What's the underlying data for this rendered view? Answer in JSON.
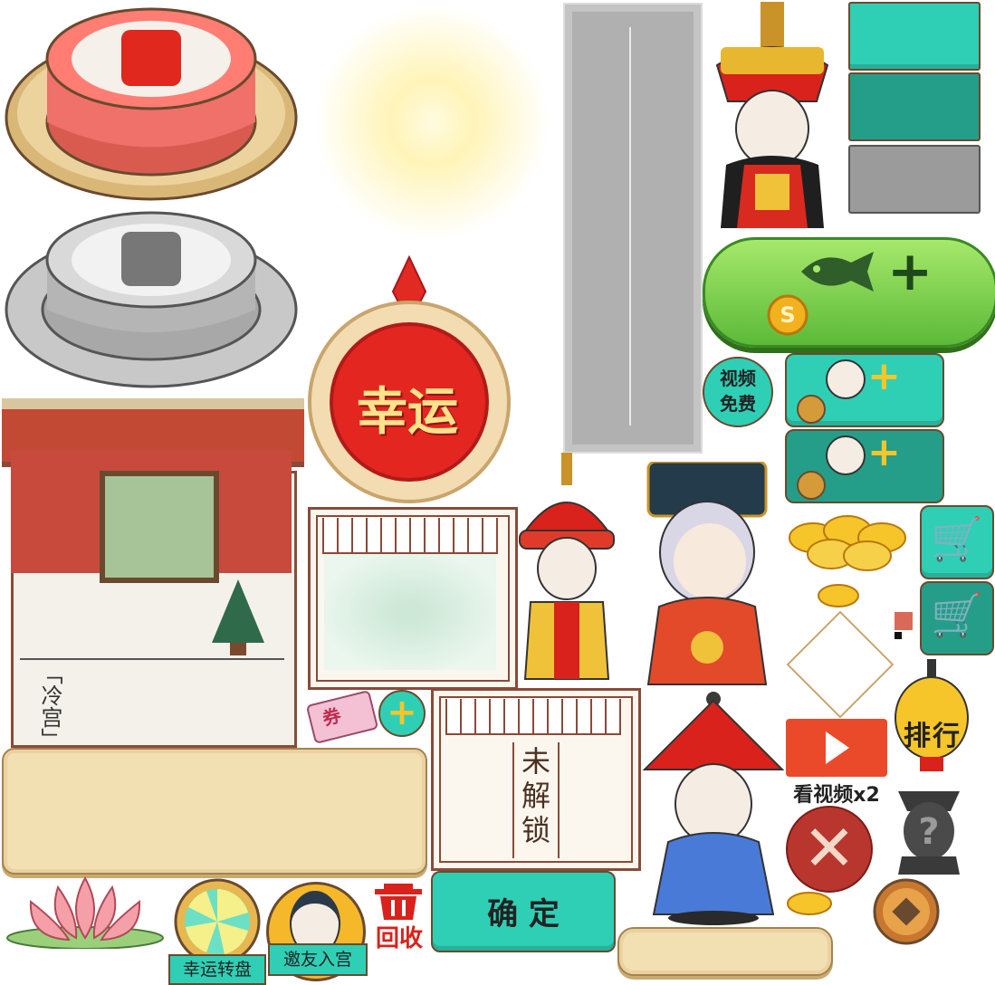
{
  "luck_badge": {
    "text": "幸运"
  },
  "video_free": {
    "line1": "视频",
    "line2": "免费"
  },
  "cold_palace": {
    "label": "「冷宫」"
  },
  "locked_panel": {
    "label": "未解锁"
  },
  "confirm_button": {
    "label": "确  定"
  },
  "lucky_wheel": {
    "label": "幸运转盘"
  },
  "invite_friends": {
    "label": "邀友入宫"
  },
  "recycle": {
    "label": "回收"
  },
  "ranking": {
    "label": "排行"
  },
  "watch_video": {
    "label": "看视频x2"
  },
  "coupon": {
    "label": "券"
  },
  "colors": {
    "accent_teal": "#2fcfb6",
    "red": "#d63a2e",
    "parchment": "#f2dfb2",
    "green": "#6cc24a"
  }
}
